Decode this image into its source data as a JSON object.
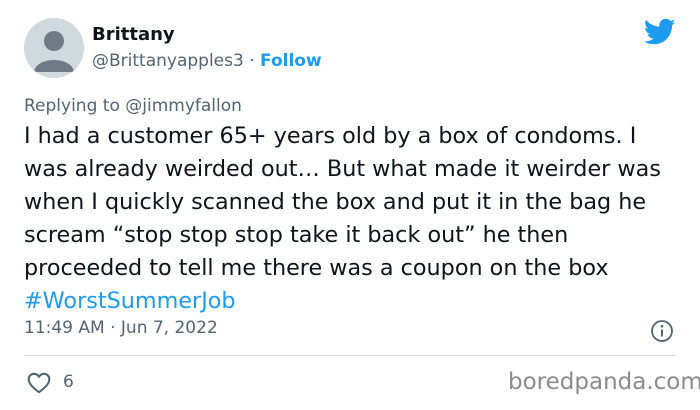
{
  "author": {
    "name": "Brittany",
    "handle": "@Brittanyapples3",
    "separator": "·",
    "follow_label": "Follow"
  },
  "reply": {
    "prefix": "Replying to",
    "handle": "@jimmyfallon"
  },
  "tweet": {
    "text": "I had a customer 65+ years old by a box of condoms. I was already weirded out… But what made it weirder was when I quickly scanned the box and put it in the bag he scream “stop stop stop take it back out” he then proceeded to tell me there was a coupon on the box",
    "hashtag": "#WorstSummerJob",
    "timestamp": "11:49 AM · Jun 7, 2022"
  },
  "engagement": {
    "likes": "6"
  },
  "watermark": "boredpanda.com",
  "icons": {
    "brand": "twitter-bird-icon",
    "info": "info-icon",
    "like": "heart-icon",
    "avatar": "default-avatar-icon"
  },
  "colors": {
    "accent": "#1d9bf0",
    "secondary_text": "#536471",
    "avatar_bg": "#cfd9de",
    "watermark": "#8b8b8b"
  }
}
